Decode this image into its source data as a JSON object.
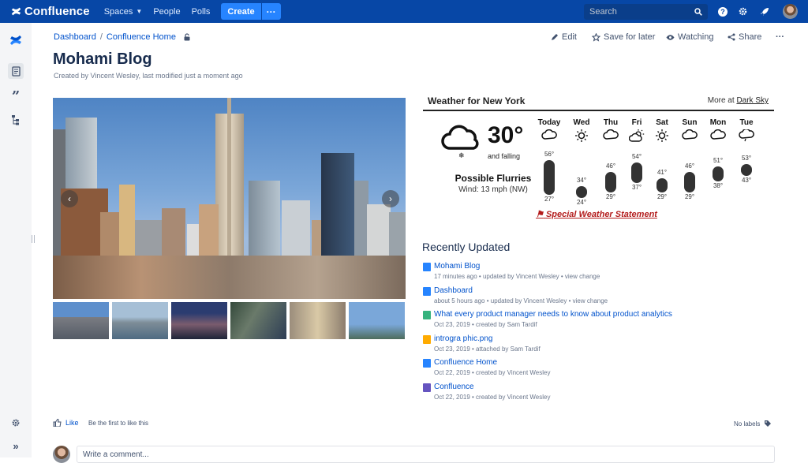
{
  "topnav": {
    "logo": "Confluence",
    "spaces": "Spaces",
    "people": "People",
    "polls": "Polls",
    "create": "Create",
    "more": "···",
    "search_placeholder": "Search"
  },
  "breadcrumb": {
    "items": [
      "Dashboard",
      "Confluence Home"
    ]
  },
  "actions": {
    "edit": "Edit",
    "save_later": "Save for later",
    "watching": "Watching",
    "share": "Share",
    "more": "···"
  },
  "page": {
    "title": "Mohami Blog",
    "byline": "Created by Vincent Wesley, last modified just a moment ago"
  },
  "gallery": {
    "prev": "‹",
    "next": "›",
    "thumb_count": 6
  },
  "weather": {
    "heading": "Weather for New York",
    "more_prefix": "More at ",
    "more_link": "Dark Sky",
    "temperature": "30°",
    "trend": "and falling",
    "summary": "Possible Flurries",
    "wind": "Wind: 13 mph (NW)",
    "alert": "Special Weather Statement",
    "days": [
      {
        "day": "Today",
        "icon": "cloud-icon",
        "high": "56°",
        "low": "27°",
        "high_val": 56,
        "low_val": 27
      },
      {
        "day": "Wed",
        "icon": "sun-icon",
        "high": "34°",
        "low": "24°",
        "high_val": 34,
        "low_val": 24
      },
      {
        "day": "Thu",
        "icon": "cloud-icon",
        "high": "46°",
        "low": "29°",
        "high_val": 46,
        "low_val": 29
      },
      {
        "day": "Fri",
        "icon": "partly-cloudy-icon",
        "high": "54°",
        "low": "37°",
        "high_val": 54,
        "low_val": 37
      },
      {
        "day": "Sat",
        "icon": "sun-icon",
        "high": "41°",
        "low": "29°",
        "high_val": 41,
        "low_val": 29
      },
      {
        "day": "Sun",
        "icon": "cloud-icon",
        "high": "46°",
        "low": "29°",
        "high_val": 46,
        "low_val": 29
      },
      {
        "day": "Mon",
        "icon": "cloud-icon",
        "high": "51°",
        "low": "38°",
        "high_val": 51,
        "low_val": 38
      },
      {
        "day": "Tue",
        "icon": "rain-icon",
        "high": "53°",
        "low": "43°",
        "high_val": 53,
        "low_val": 43
      }
    ]
  },
  "recently_updated": {
    "title": "Recently Updated",
    "items": [
      {
        "title": "Mohami Blog",
        "meta": "17 minutes ago • updated by Vincent Wesley • view change",
        "icon": "page-icon",
        "color": "#2684ff"
      },
      {
        "title": "Dashboard",
        "meta": "about 5 hours ago • updated by Vincent Wesley • view change",
        "icon": "page-icon",
        "color": "#2684ff"
      },
      {
        "title": "What every product manager needs to know about product analytics",
        "meta": "Oct 23, 2019 • created by Sam Tardif",
        "icon": "blog-icon",
        "color": "#36b37e"
      },
      {
        "title": "introgra phic.png",
        "meta": "Oct 23, 2019 • attached by Sam Tardif",
        "icon": "image-icon",
        "color": "#ffab00"
      },
      {
        "title": "Confluence Home",
        "meta": "Oct 22, 2019 • created by Vincent Wesley",
        "icon": "page-icon",
        "color": "#2684ff"
      },
      {
        "title": "Confluence",
        "meta": "Oct 22, 2019 • created by Vincent Wesley",
        "icon": "space-icon",
        "color": "#6554c0"
      }
    ]
  },
  "footer": {
    "like": "Like",
    "like_hint": "Be the first to like this",
    "no_labels": "No labels",
    "comment_placeholder": "Write a comment..."
  }
}
